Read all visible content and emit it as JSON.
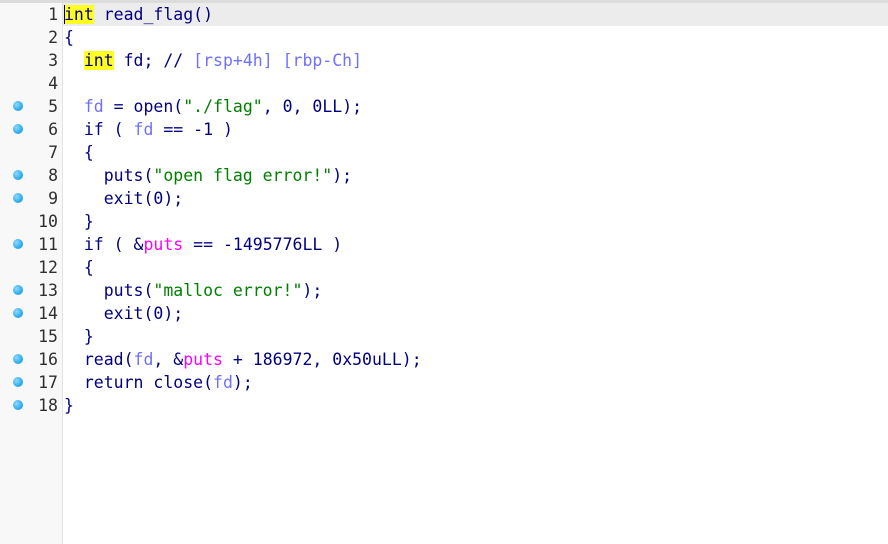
{
  "lines": [
    {
      "num": "1",
      "bp": false,
      "tokens": [
        {
          "t": "int",
          "c": "kwhl-cursor"
        },
        {
          "t": " read_flag()",
          "c": "kw"
        }
      ]
    },
    {
      "num": "2",
      "bp": false,
      "tokens": [
        {
          "t": "{",
          "c": "kw"
        }
      ]
    },
    {
      "num": "3",
      "bp": false,
      "tokens": [
        {
          "t": "  ",
          "c": "kw"
        },
        {
          "t": "int",
          "c": "kwhl"
        },
        {
          "t": " fd; // ",
          "c": "kw"
        },
        {
          "t": "[rsp+4h] [rbp-Ch]",
          "c": "cmv"
        }
      ]
    },
    {
      "num": "4",
      "bp": false,
      "tokens": []
    },
    {
      "num": "5",
      "bp": true,
      "tokens": [
        {
          "t": "  ",
          "c": "kw"
        },
        {
          "t": "fd",
          "c": "var"
        },
        {
          "t": " = open(",
          "c": "kw"
        },
        {
          "t": "\"./flag\"",
          "c": "str"
        },
        {
          "t": ", 0, 0LL);",
          "c": "kw"
        }
      ]
    },
    {
      "num": "6",
      "bp": true,
      "tokens": [
        {
          "t": "  if ( ",
          "c": "kw"
        },
        {
          "t": "fd",
          "c": "var"
        },
        {
          "t": " == -1 )",
          "c": "kw"
        }
      ]
    },
    {
      "num": "7",
      "bp": false,
      "tokens": [
        {
          "t": "  {",
          "c": "kw"
        }
      ]
    },
    {
      "num": "8",
      "bp": true,
      "tokens": [
        {
          "t": "    puts(",
          "c": "kw"
        },
        {
          "t": "\"open flag error!\"",
          "c": "str"
        },
        {
          "t": ");",
          "c": "kw"
        }
      ]
    },
    {
      "num": "9",
      "bp": true,
      "tokens": [
        {
          "t": "    exit(0);",
          "c": "kw"
        }
      ]
    },
    {
      "num": "10",
      "bp": false,
      "tokens": [
        {
          "t": "  }",
          "c": "kw"
        }
      ]
    },
    {
      "num": "11",
      "bp": true,
      "tokens": [
        {
          "t": "  if ( &",
          "c": "kw"
        },
        {
          "t": "puts",
          "c": "imp"
        },
        {
          "t": " == -1495776LL )",
          "c": "kw"
        }
      ]
    },
    {
      "num": "12",
      "bp": false,
      "tokens": [
        {
          "t": "  {",
          "c": "kw"
        }
      ]
    },
    {
      "num": "13",
      "bp": true,
      "tokens": [
        {
          "t": "    puts(",
          "c": "kw"
        },
        {
          "t": "\"malloc error!\"",
          "c": "str"
        },
        {
          "t": ");",
          "c": "kw"
        }
      ]
    },
    {
      "num": "14",
      "bp": true,
      "tokens": [
        {
          "t": "    exit(0);",
          "c": "kw"
        }
      ]
    },
    {
      "num": "15",
      "bp": false,
      "tokens": [
        {
          "t": "  }",
          "c": "kw"
        }
      ]
    },
    {
      "num": "16",
      "bp": true,
      "tokens": [
        {
          "t": "  read(",
          "c": "kw"
        },
        {
          "t": "fd",
          "c": "var"
        },
        {
          "t": ", &",
          "c": "kw"
        },
        {
          "t": "puts",
          "c": "imp"
        },
        {
          "t": " + 186972, 0x50uLL);",
          "c": "kw"
        }
      ]
    },
    {
      "num": "17",
      "bp": true,
      "tokens": [
        {
          "t": "  return close(",
          "c": "kw"
        },
        {
          "t": "fd",
          "c": "var"
        },
        {
          "t": ");",
          "c": "kw"
        }
      ]
    },
    {
      "num": "18",
      "bp": true,
      "tokens": [
        {
          "t": "}",
          "c": "kw"
        }
      ]
    }
  ]
}
